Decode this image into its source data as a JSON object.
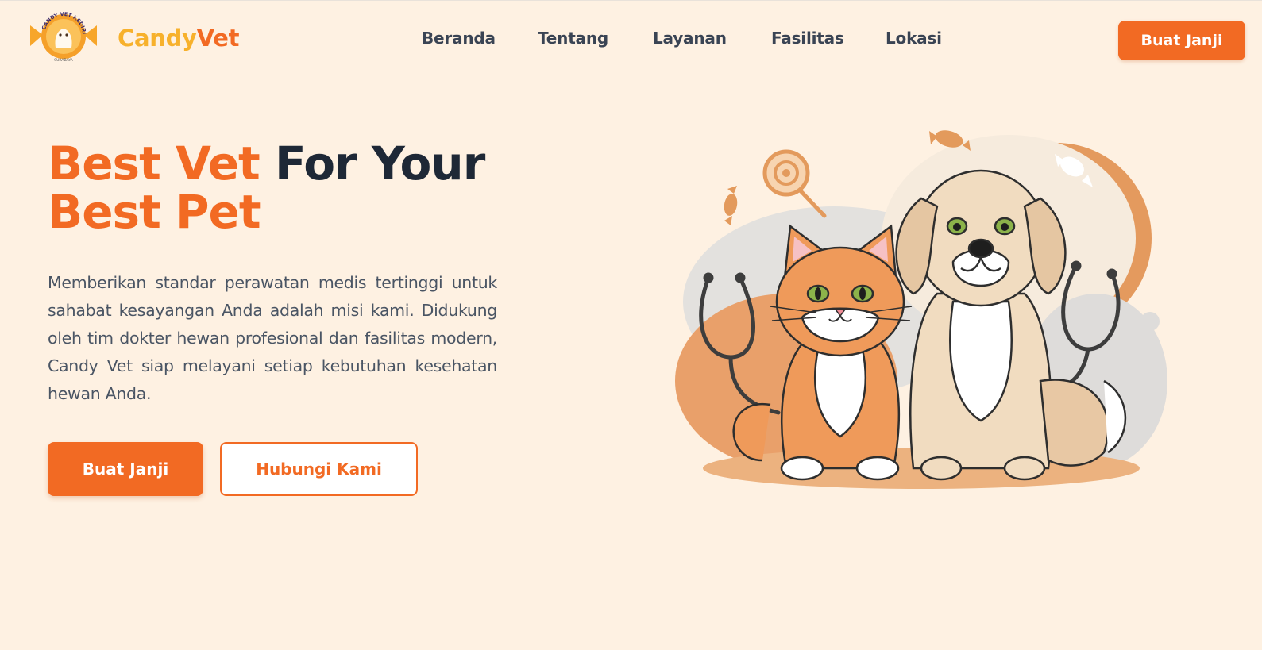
{
  "brand": {
    "name_part1": "Candy",
    "name_part2": "Vet",
    "logo_arc_text": "CANDY VET KEDIRIAN",
    "logo_bottom_text": "SURABAYA"
  },
  "nav": {
    "items": [
      {
        "label": "Beranda"
      },
      {
        "label": "Tentang"
      },
      {
        "label": "Layanan"
      },
      {
        "label": "Fasilitas"
      },
      {
        "label": "Lokasi"
      }
    ]
  },
  "header": {
    "cta_label": "Buat Janji"
  },
  "hero": {
    "title_orange_1": "Best Vet",
    "title_dark": "For Your",
    "title_orange_2": "Best Pet",
    "description": "Memberikan standar perawatan medis tertinggi untuk sahabat kesayangan Anda adalah misi kami. Didukung oleh tim dokter hewan profesional dan fasilitas modern, Candy Vet siap melayani setiap kebutuhan kesehatan hewan Anda.",
    "primary_button": "Buat Janji",
    "secondary_button": "Hubungi Kami",
    "illustration_icons": [
      "cat-icon",
      "dog-icon",
      "stethoscope-icon",
      "lollipop-icon",
      "candy-icon"
    ]
  },
  "colors": {
    "background": "#fef1e2",
    "accent": "#f26a23",
    "brand_yellow": "#f7b12c",
    "heading_dark": "#1e2836",
    "nav_text": "#3a4454",
    "body_text": "#4a5564"
  }
}
